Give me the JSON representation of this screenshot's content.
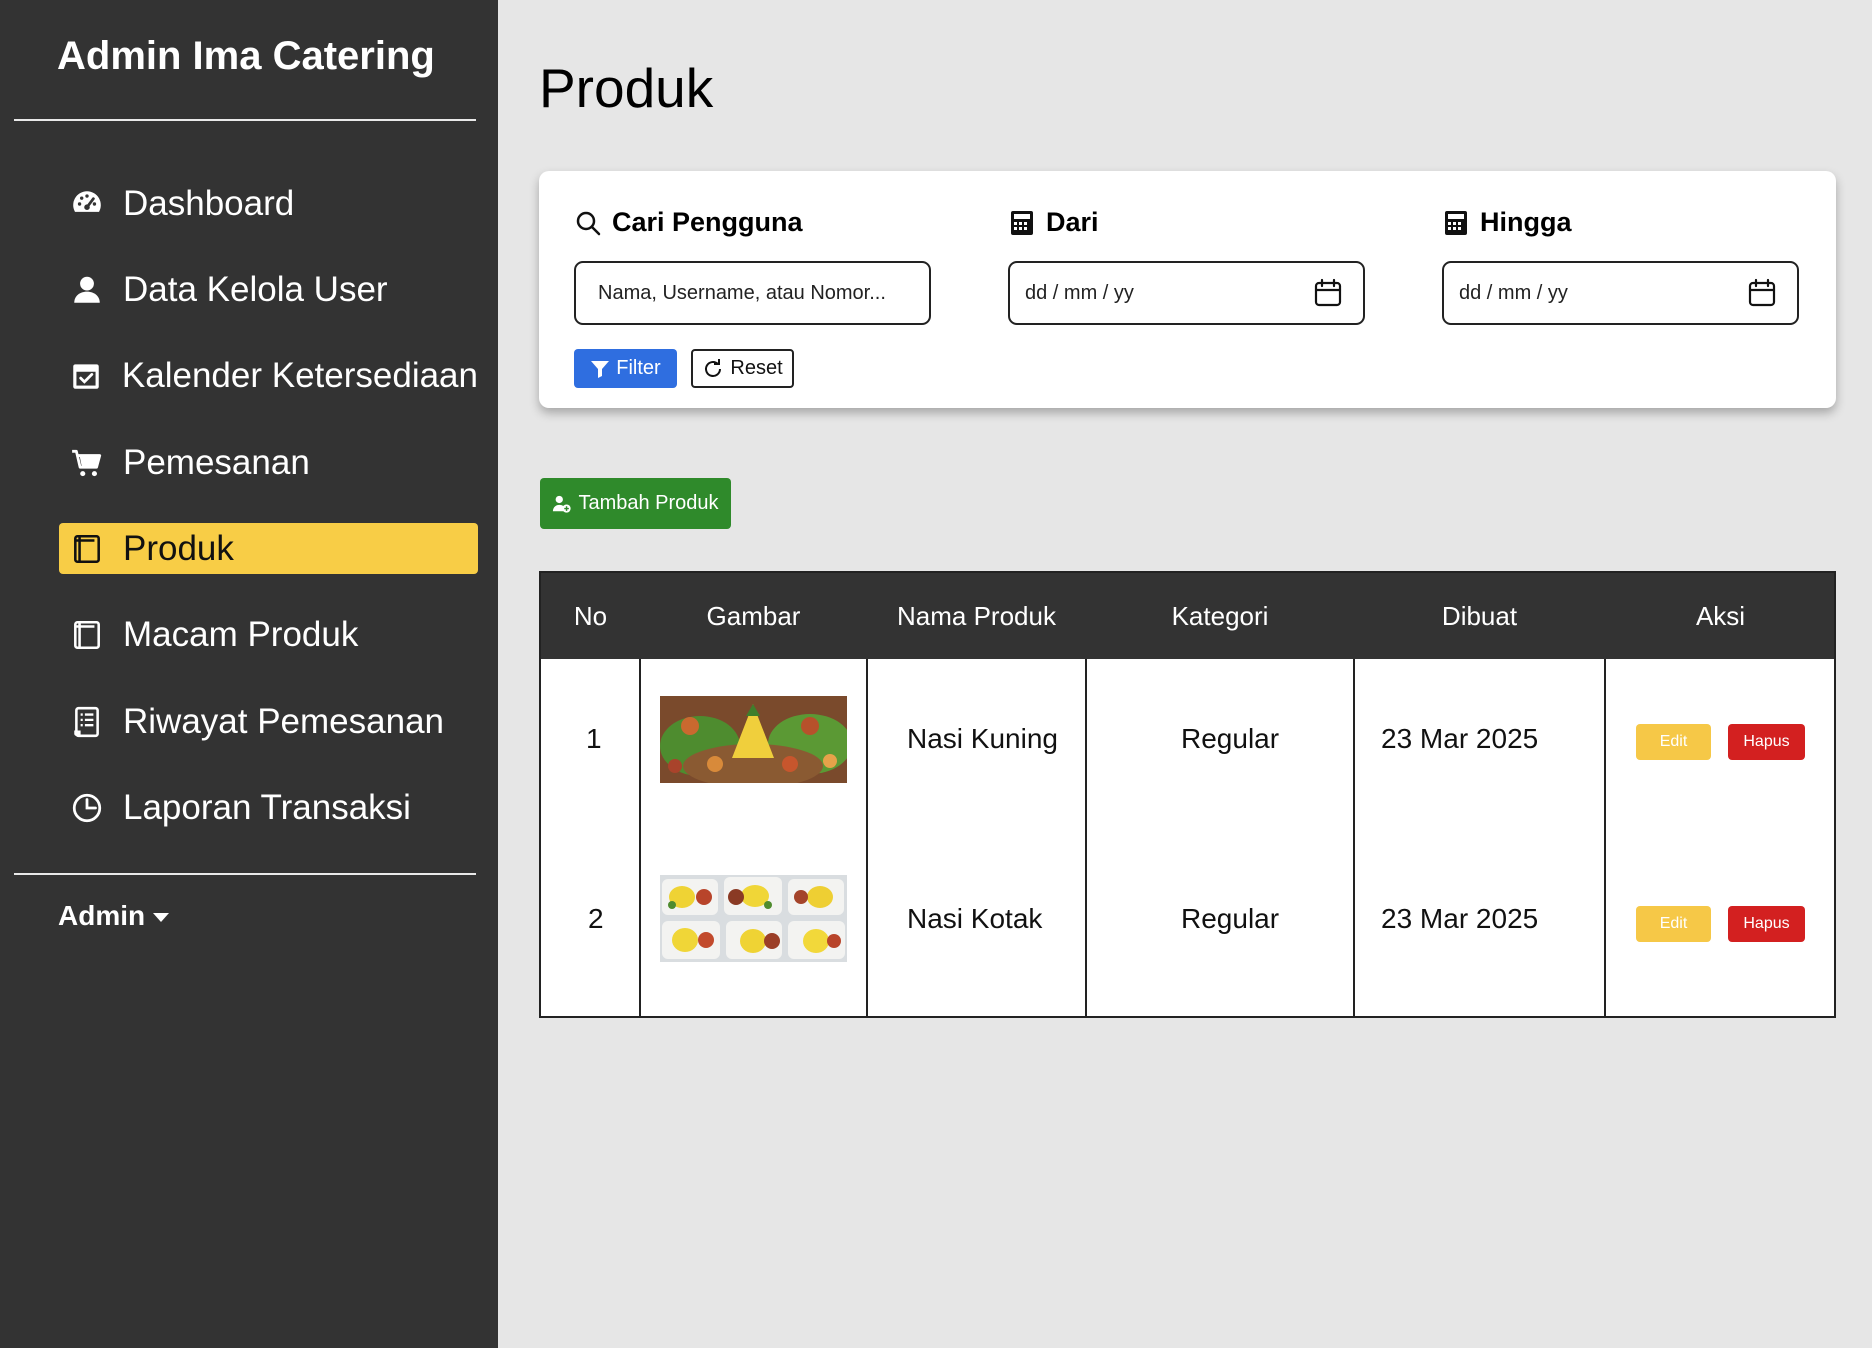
{
  "sidebar": {
    "brand": "Admin Ima Catering",
    "items": [
      {
        "label": "Dashboard",
        "icon": "dashboard-gauge-icon"
      },
      {
        "label": "Data Kelola User",
        "icon": "user-icon"
      },
      {
        "label": "Kalender Ketersediaan",
        "icon": "calendar-check-icon"
      },
      {
        "label": "Pemesanan",
        "icon": "cart-icon"
      },
      {
        "label": "Produk",
        "icon": "product-box-icon",
        "active": true
      },
      {
        "label": "Macam Produk",
        "icon": "product-box-icon"
      },
      {
        "label": "Riwayat Pemesanan",
        "icon": "receipt-list-icon"
      },
      {
        "label": "Laporan Transaksi",
        "icon": "clock-report-icon"
      }
    ],
    "user": "Admin"
  },
  "page": {
    "title": "Produk"
  },
  "filter": {
    "search_label": "Cari Pengguna",
    "search_placeholder": "Nama, Username, atau Nomor...",
    "from_label": "Dari",
    "from_value": "dd / mm / yy",
    "to_label": "Hingga",
    "to_value": "dd / mm / yy",
    "filter_button": "Filter",
    "reset_button": "Reset"
  },
  "actions": {
    "add_button": "Tambah Produk"
  },
  "table": {
    "headers": [
      "No",
      "Gambar",
      "Nama Produk",
      "Kategori",
      "Dibuat",
      "Aksi"
    ],
    "rows": [
      {
        "no": "1",
        "image": "tumpeng nasi kuning photo",
        "name": "Nasi Kuning",
        "category": "Regular",
        "created": "23 Mar 2025",
        "edit": "Edit",
        "delete": "Hapus"
      },
      {
        "no": "2",
        "image": "nasi kotak boxes photo",
        "name": "Nasi Kotak",
        "category": "Regular",
        "created": "23 Mar 2025",
        "edit": "Edit",
        "delete": "Hapus"
      }
    ]
  },
  "colors": {
    "sidebar_bg": "#333333",
    "page_bg": "#e6e6e6",
    "active_item": "#f8cd46",
    "filter_button": "#2f6ee0",
    "add_button": "#2f8a2b",
    "edit_button": "#f6c847",
    "delete_button": "#d32020"
  }
}
